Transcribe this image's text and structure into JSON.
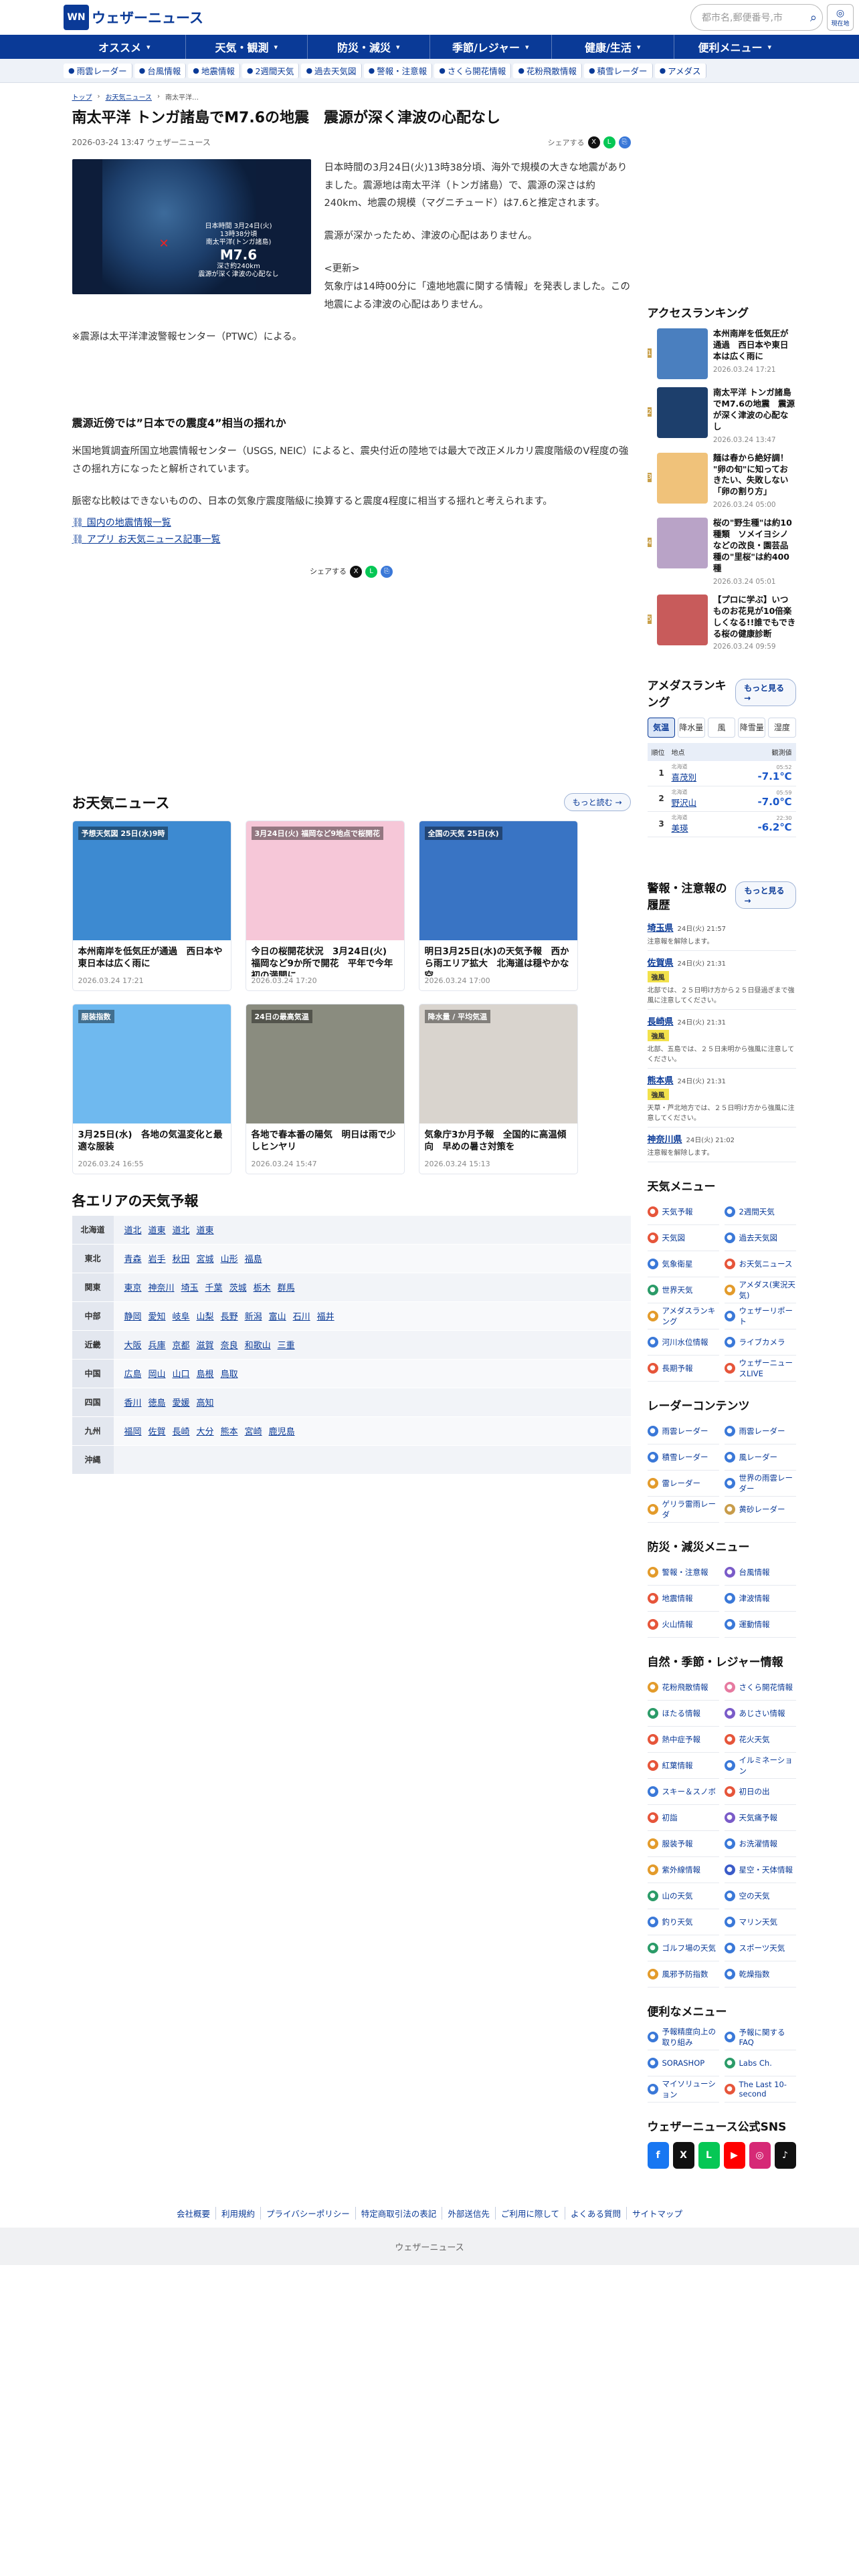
{
  "header": {
    "logo_mark": "WN",
    "logo_text": "ウェザーニュース",
    "search_placeholder": "都市名,郵便番号,市",
    "location_label": "現在地"
  },
  "gnav": [
    "オススメ",
    "天気・観測",
    "防災・減災",
    "季節/レジャー",
    "健康/生活",
    "便利メニュー"
  ],
  "subnav": [
    "雨雲レーダー",
    "台風情報",
    "地震情報",
    "2週間天気",
    "過去天気図",
    "警報・注意報",
    "さくら開花情報",
    "花粉飛散情報",
    "積雪レーダー",
    "アメダス"
  ],
  "breadcrumbs": [
    "トップ",
    "お天気ニュース",
    "南太平洋…"
  ],
  "article": {
    "title": "南太平洋 トンガ諸島でM7.6の地震　震源が深く津波の心配なし",
    "date": "2026-03-24 13:47 ウェザーニュース",
    "share_label": "シェアする",
    "figure": {
      "line1": "日本時間 3月24日(火)",
      "line2": "13時38分頃",
      "line3": "南太平洋(トンガ諸島)",
      "mag": "M7.6",
      "line4": "深さ約240km",
      "line5": "震源が深く津波の心配なし"
    },
    "p1": "日本時間の3月24日(火)13時38分頃、海外で規模の大きな地震がありました。震源地は南太平洋（トンガ諸島）で、震源の深さは約240km、地震の規模（マグニチュード）は7.6と推定されます。",
    "p2": "震源が深かったため、津波の心配はありません。",
    "p3": "<更新>\n気象庁は14時00分に「遠地地震に関する情報」を発表しました。この地震による津波の心配はありません。",
    "p4": "※震源は太平洋津波警報センター（PTWC）による。",
    "h2": "震源近傍では”日本での震度4”相当の揺れか",
    "p5": "米国地質調査所国立地震情報センター（USGS, NEIC）によると、震央付近の陸地では最大で改正メルカリ震度階級のV程度の強さの揺れ方になったと解析されています。",
    "p6": "脈密な比較はできないものの、日本の気象庁震度階級に換算すると震度4程度に相当する揺れと考えられます。",
    "link1": "国内の地震情報一覧",
    "link2": "アプリ お天気ニュース記事一覧"
  },
  "news_section": {
    "title": "お天気ニュース",
    "more": "もっと読む"
  },
  "news": [
    {
      "title": "本州南岸を低気圧が通過　西日本や東日本は広く雨に",
      "date": "2026.03.24 17:21",
      "thumb": "予想天気図 25日(水)9時",
      "color": "#3d8ad1"
    },
    {
      "title": "今日の桜開花状況　3月24日(火)　福岡など9か所で開花　平年で今年初の満開に",
      "date": "2026.03.24 17:20",
      "thumb": "3月24日(火) 福岡など9地点で桜開花",
      "color": "#f6c7d8"
    },
    {
      "title": "明日3月25日(水)の天気予報　西から雨エリア拡大　北海道は穏やかな空",
      "date": "2026.03.24 17:00",
      "thumb": "全国の天気 25日(水)",
      "color": "#3974c4"
    },
    {
      "title": "3月25日(水)　各地の気温変化と最適な服装",
      "date": "2026.03.24 16:55",
      "thumb": "服装指数",
      "color": "#6fb9ef"
    },
    {
      "title": "各地で春本番の陽気　明日は雨で少しヒンヤリ",
      "date": "2026.03.24 15:47",
      "thumb": "24日の最高気温",
      "color": "#8a8c7f"
    },
    {
      "title": "気象庁3か月予報　全国的に高温傾向　早めの暑さ対策を",
      "date": "2026.03.24 15:13",
      "thumb": "降水量 / 平均気温",
      "color": "#d9d4ce"
    }
  ],
  "areas": {
    "title": "各エリアの天気予報",
    "rows": [
      {
        "region": "北海道",
        "prefs": [
          "道北",
          "道東",
          "道北",
          "道東"
        ]
      },
      {
        "region": "東北",
        "prefs": [
          "青森",
          "岩手",
          "秋田",
          "宮城",
          "山形",
          "福島"
        ]
      },
      {
        "region": "関東",
        "prefs": [
          "東京",
          "神奈川",
          "埼玉",
          "千葉",
          "茨城",
          "栃木",
          "群馬"
        ]
      },
      {
        "region": "中部",
        "prefs": [
          "静岡",
          "愛知",
          "岐阜",
          "山梨",
          "長野",
          "新潟",
          "富山",
          "石川",
          "福井"
        ]
      },
      {
        "region": "近畿",
        "prefs": [
          "大阪",
          "兵庫",
          "京都",
          "滋賀",
          "奈良",
          "和歌山",
          "三重"
        ]
      },
      {
        "region": "中国",
        "prefs": [
          "広島",
          "岡山",
          "山口",
          "島根",
          "鳥取"
        ]
      },
      {
        "region": "四国",
        "prefs": [
          "香川",
          "徳島",
          "愛媛",
          "高知"
        ]
      },
      {
        "region": "九州",
        "prefs": [
          "福岡",
          "佐賀",
          "長崎",
          "大分",
          "熊本",
          "宮崎",
          "鹿児島"
        ]
      },
      {
        "region": "沖縄",
        "prefs": []
      }
    ]
  },
  "access_ranking": {
    "title": "アクセスランキング",
    "items": [
      {
        "n": "1",
        "title": "本州南岸を低気圧が通過　西日本や東日本は広く雨に",
        "date": "2026.03.24 17:21",
        "color": "#4a7fbf"
      },
      {
        "n": "2",
        "title": "南太平洋 トンガ諸島でM7.6の地震　震源が深く津波の心配なし",
        "date": "2026.03.24 13:47",
        "color": "#1d3f6c"
      },
      {
        "n": "3",
        "title": "麺は春から絶好調！ \"卵の旬\"に知っておきたい、失敗しない「卵の割り方」",
        "date": "2026.03.24 05:00",
        "color": "#f0c27a"
      },
      {
        "n": "4",
        "title": "桜の\"野生種\"は約10種類　ソメイヨシノなどの改良・園芸品種の\"里桜\"は約400種",
        "date": "2026.03.24 05:01",
        "color": "#b9a3c7"
      },
      {
        "n": "5",
        "title": "【プロに学ぶ】いつものお花見が10倍楽しくなる!!誰でもできる桜の健康診断",
        "date": "2026.03.24 09:59",
        "color": "#c85b5b"
      }
    ]
  },
  "amedas": {
    "title": "アメダスランキング",
    "more": "もっと見る",
    "tabs": [
      "気温",
      "降水量",
      "風",
      "降雪量",
      "湿度"
    ],
    "head_left": "順位　地点",
    "head_right": "観測値",
    "rows": [
      {
        "rank": "1",
        "pref": "北海道",
        "name": "喜茂別",
        "time": "05:52",
        "val": "-7.1℃"
      },
      {
        "rank": "2",
        "pref": "北海道",
        "name": "野沢山",
        "time": "05:59",
        "val": "-7.0℃"
      },
      {
        "rank": "3",
        "pref": "北海道",
        "name": "美瑛",
        "time": "22:30",
        "val": "-6.2℃"
      }
    ]
  },
  "warnings": {
    "title": "警報・注意報の履歴",
    "more": "もっと見る",
    "items": [
      {
        "pref": "埼玉県",
        "time": "24日(火) 21:57",
        "note": "注意報を解除します。",
        "badge": ""
      },
      {
        "pref": "佐賀県",
        "time": "24日(火) 21:31",
        "note": "北部では、２５日明け方から２５日昼過ぎまで強風に注意してください。",
        "badge": "強風"
      },
      {
        "pref": "長崎県",
        "time": "24日(火) 21:31",
        "note": "北部、五島では、２５日未明から強風に注意してください。",
        "badge": "強風"
      },
      {
        "pref": "熊本県",
        "time": "24日(火) 21:31",
        "note": "天草・芦北地方では、２５日明け方から強風に注意してください。",
        "badge": "強風"
      },
      {
        "pref": "神奈川県",
        "time": "24日(火) 21:02",
        "note": "注意報を解除します。",
        "badge": ""
      }
    ]
  },
  "weather_menu": {
    "title": "天気メニュー",
    "items": [
      {
        "label": "天気予報",
        "color": "#e6553a"
      },
      {
        "label": "2週間天気",
        "color": "#3a78d8"
      },
      {
        "label": "天気図",
        "color": "#e6553a"
      },
      {
        "label": "過去天気図",
        "color": "#3a78d8"
      },
      {
        "label": "気象衛星",
        "color": "#3a78d8"
      },
      {
        "label": "お天気ニュース",
        "color": "#e6553a"
      },
      {
        "label": "世界天気",
        "color": "#2b9b68"
      },
      {
        "label": "アメダス(実況天気)",
        "color": "#e39b2b"
      },
      {
        "label": "アメダスランキング",
        "color": "#e39b2b"
      },
      {
        "label": "ウェザーリポート",
        "color": "#3a78d8"
      },
      {
        "label": "河川水位情報",
        "color": "#3a78d8"
      },
      {
        "label": "ライブカメラ",
        "color": "#3a78d8"
      },
      {
        "label": "長期予報",
        "color": "#e6553a"
      },
      {
        "label": "ウェザーニュースLIVE",
        "color": "#e6553a"
      }
    ]
  },
  "radar": {
    "title": "レーダーコンテンツ",
    "items": [
      {
        "label": "雨雲レーダー",
        "color": "#3a78d8"
      },
      {
        "label": "雨雲レーダー",
        "color": "#3a78d8"
      },
      {
        "label": "積雪レーダー",
        "color": "#3a78d8"
      },
      {
        "label": "風レーダー",
        "color": "#3a78d8"
      },
      {
        "label": "雷レーダー",
        "color": "#e39b2b"
      },
      {
        "label": "世界の雨雲レーダー",
        "color": "#3a78d8"
      },
      {
        "label": "ゲリラ雷雨レーダ",
        "color": "#e39b2b"
      },
      {
        "label": "黄砂レーダー",
        "color": "#c89c4a"
      }
    ]
  },
  "disaster": {
    "title": "防災・減災メニュー",
    "items": [
      {
        "label": "警報・注意報",
        "color": "#e39b2b"
      },
      {
        "label": "台風情報",
        "color": "#7a5bc8"
      },
      {
        "label": "地震情報",
        "color": "#e6553a"
      },
      {
        "label": "津波情報",
        "color": "#3a78d8"
      },
      {
        "label": "火山情報",
        "color": "#e6553a"
      },
      {
        "label": "運動情報",
        "color": "#3a78d8"
      }
    ]
  },
  "leisure": {
    "title": "自然・季節・レジャー情報",
    "items": [
      {
        "label": "花粉飛散情報",
        "color": "#e39b2b"
      },
      {
        "label": "さくら開花情報",
        "color": "#e67aa0"
      },
      {
        "label": "ほたる情報",
        "color": "#2b9b68"
      },
      {
        "label": "あじさい情報",
        "color": "#7a5bc8"
      },
      {
        "label": "熱中症予報",
        "color": "#e6553a"
      },
      {
        "label": "花火天気",
        "color": "#e6553a"
      },
      {
        "label": "紅葉情報",
        "color": "#e6553a"
      },
      {
        "label": "イルミネーション",
        "color": "#3a78d8"
      },
      {
        "label": "スキー＆スノボ",
        "color": "#3a78d8"
      },
      {
        "label": "初日の出",
        "color": "#e6553a"
      },
      {
        "label": "初詣",
        "color": "#e6553a"
      },
      {
        "label": "天気痛予報",
        "color": "#7a5bc8"
      },
      {
        "label": "服装予報",
        "color": "#e39b2b"
      },
      {
        "label": "お洗濯情報",
        "color": "#3a78d8"
      },
      {
        "label": "紫外線情報",
        "color": "#e39b2b"
      },
      {
        "label": "星空・天体情報",
        "color": "#3a5bc8"
      },
      {
        "label": "山の天気",
        "color": "#2b9b68"
      },
      {
        "label": "空の天気",
        "color": "#3a78d8"
      },
      {
        "label": "釣り天気",
        "color": "#3a78d8"
      },
      {
        "label": "マリン天気",
        "color": "#3a78d8"
      },
      {
        "label": "ゴルフ場の天気",
        "color": "#2b9b68"
      },
      {
        "label": "スポーツ天気",
        "color": "#3a78d8"
      },
      {
        "label": "風邪予防指数",
        "color": "#e39b2b"
      },
      {
        "label": "乾燥指数",
        "color": "#3a78d8"
      }
    ]
  },
  "convenient": {
    "title": "便利なメニュー",
    "items": [
      {
        "label": "予報精度向上の取り組み",
        "color": "#3a78d8"
      },
      {
        "label": "予報に関するFAQ",
        "color": "#3a78d8"
      },
      {
        "label": "SORASHOP",
        "color": "#3a78d8"
      },
      {
        "label": "Labs Ch.",
        "color": "#2b9b68"
      },
      {
        "label": "マイソリューション",
        "color": "#3a78d8"
      },
      {
        "label": "The Last 10-second",
        "color": "#e6553a"
      }
    ]
  },
  "sns": {
    "title": "ウェザーニュース公式SNS",
    "items": [
      {
        "label": "f",
        "color": "#1877f2",
        "name": "facebook-icon"
      },
      {
        "label": "X",
        "color": "#111111",
        "name": "x-icon"
      },
      {
        "label": "L",
        "color": "#06c755",
        "name": "line-icon"
      },
      {
        "label": "▶",
        "color": "#ff0000",
        "name": "youtube-icon"
      },
      {
        "label": "◎",
        "color": "#d62976",
        "name": "instagram-icon"
      },
      {
        "label": "♪",
        "color": "#111111",
        "name": "tiktok-icon"
      }
    ]
  },
  "footer": {
    "links": [
      "会社概要",
      "利用規約",
      "プライバシーポリシー",
      "特定商取引法の表記",
      "外部送信先",
      "ご利用に際して",
      "よくある質問",
      "サイトマップ"
    ],
    "copyright": "ウェザーニュース"
  }
}
